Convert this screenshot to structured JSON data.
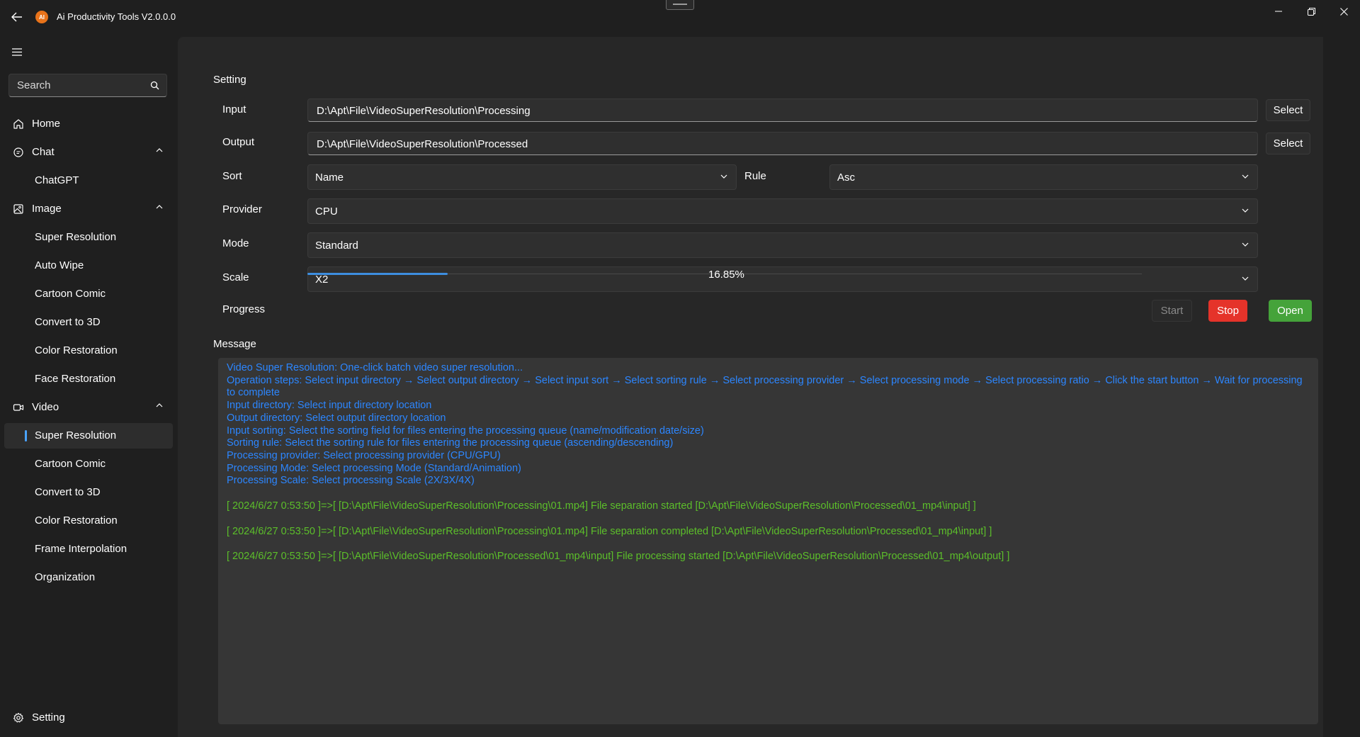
{
  "app": {
    "title": "Ai Productivity Tools V2.0.0.0",
    "logo_text": "AI",
    "accent_color": "#4aa3ff"
  },
  "sidebar": {
    "search_placeholder": "Search",
    "items": [
      {
        "label": "Home",
        "icon": "home-icon"
      },
      {
        "label": "Chat",
        "icon": "chat-icon",
        "expanded": true
      },
      {
        "label": "ChatGPT"
      },
      {
        "label": "Image",
        "icon": "image-icon",
        "expanded": true
      },
      {
        "label": "Super Resolution"
      },
      {
        "label": "Auto Wipe"
      },
      {
        "label": "Cartoon Comic"
      },
      {
        "label": "Convert to 3D"
      },
      {
        "label": "Color Restoration"
      },
      {
        "label": "Face Restoration"
      },
      {
        "label": "Video",
        "icon": "video-icon",
        "expanded": true
      },
      {
        "label": "Super Resolution",
        "selected": true
      },
      {
        "label": "Cartoon Comic"
      },
      {
        "label": "Convert to 3D"
      },
      {
        "label": "Color Restoration"
      },
      {
        "label": "Frame Interpolation"
      },
      {
        "label": "Organization"
      }
    ],
    "footer": {
      "label": "Setting",
      "icon": "gear-icon"
    }
  },
  "setting": {
    "title": "Setting",
    "input": {
      "label": "Input",
      "value": "D:\\Apt\\File\\VideoSuperResolution\\Processing",
      "button": "Select"
    },
    "output": {
      "label": "Output",
      "value": "D:\\Apt\\File\\VideoSuperResolution\\Processed",
      "button": "Select"
    },
    "sort": {
      "label": "Sort",
      "value": "Name"
    },
    "rule": {
      "label": "Rule",
      "value": "Asc"
    },
    "provider": {
      "label": "Provider",
      "value": "CPU"
    },
    "mode": {
      "label": "Mode",
      "value": "Standard"
    },
    "scale": {
      "label": "Scale",
      "value": "X2"
    },
    "progress": {
      "label": "Progress",
      "value": 16.85,
      "text": "16.85%"
    },
    "buttons": {
      "start": "Start",
      "stop": "Stop",
      "open": "Open"
    },
    "colors": {
      "stop": "#e5332a",
      "open": "#45a33a",
      "progress": "#3d8ee0"
    }
  },
  "message": {
    "title": "Message",
    "info_color": "#2c86ff",
    "log_color": "#5cbf2a",
    "info_lines": [
      "Video Super Resolution: One-click batch video super resolution...",
      "Operation steps: Select input directory → Select output directory → Select input sort → Select sorting rule → Select processing provider → Select processing mode → Select processing ratio → Click the start button → Wait for processing to complete",
      "Input directory: Select input directory location",
      "Output directory: Select output directory location",
      "Input sorting: Select the sorting field for files entering the processing queue (name/modification date/size)",
      "Sorting rule: Select the sorting rule for files entering the processing queue (ascending/descending)",
      "Processing provider: Select processing provider (CPU/GPU)",
      "Processing Mode: Select processing Mode (Standard/Animation)",
      "Processing Scale: Select processing Scale (2X/3X/4X)"
    ],
    "log_lines": [
      "[ 2024/6/27 0:53:50 ]=>[ [D:\\Apt\\File\\VideoSuperResolution\\Processing\\01.mp4] File separation started [D:\\Apt\\File\\VideoSuperResolution\\Processed\\01_mp4\\input] ]",
      "[ 2024/6/27 0:53:50 ]=>[ [D:\\Apt\\File\\VideoSuperResolution\\Processing\\01.mp4] File separation completed [D:\\Apt\\File\\VideoSuperResolution\\Processed\\01_mp4\\input] ]",
      "[ 2024/6/27 0:53:50 ]=>[ [D:\\Apt\\File\\VideoSuperResolution\\Processed\\01_mp4\\input] File processing started [D:\\Apt\\File\\VideoSuperResolution\\Processed\\01_mp4\\output] ]"
    ]
  }
}
